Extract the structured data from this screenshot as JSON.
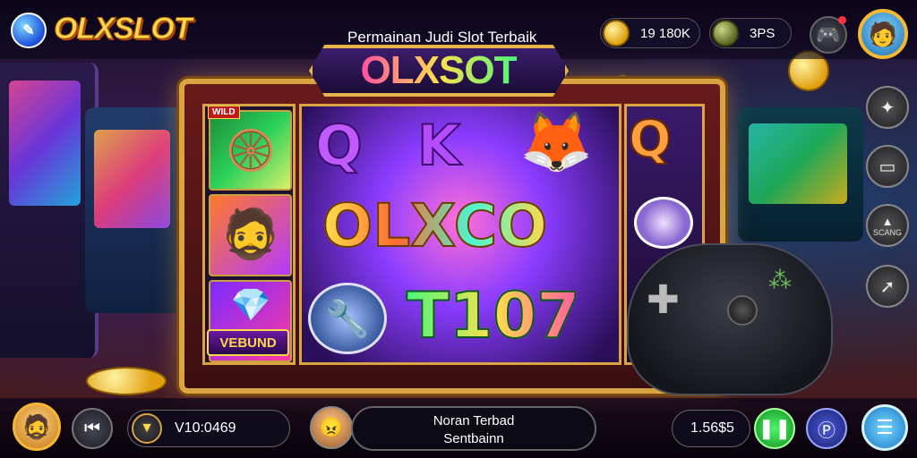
{
  "header": {
    "logo_text": "OLXSLOT",
    "tagline": "Permainan Judi Slot Terbaik",
    "coins_value": "19 180K",
    "gems_value": "3PS"
  },
  "machine": {
    "banner_text": "OLXSOT",
    "wild_tag": "WILD",
    "bonus_tag": "VEBUND",
    "symbols": {
      "q": "Q",
      "k": "K",
      "olxco": "OLXCO",
      "t107": "T107",
      "q2": "Q"
    }
  },
  "side_menu": {
    "item3_label": "SCANG"
  },
  "footer": {
    "bet_value": "V10:0469",
    "message_line1": "Noran Terbad",
    "message_line2": "Sentbainn",
    "balance_value": "1.56$5"
  },
  "icons": {
    "logo": "logo-badge-icon",
    "coin": "coin-icon",
    "gem": "gem-icon",
    "gamepad": "gamepad-icon",
    "profile": "profile-avatar-icon",
    "prev": "previous-icon",
    "play": "play-pause-icon",
    "p": "p-badge-icon",
    "menu": "menu-icon"
  },
  "colors": {
    "accent_gold": "#ffd84a",
    "frame_gold": "#d9a441",
    "play_green": "#12901f",
    "menu_blue": "#1a7ac8"
  }
}
